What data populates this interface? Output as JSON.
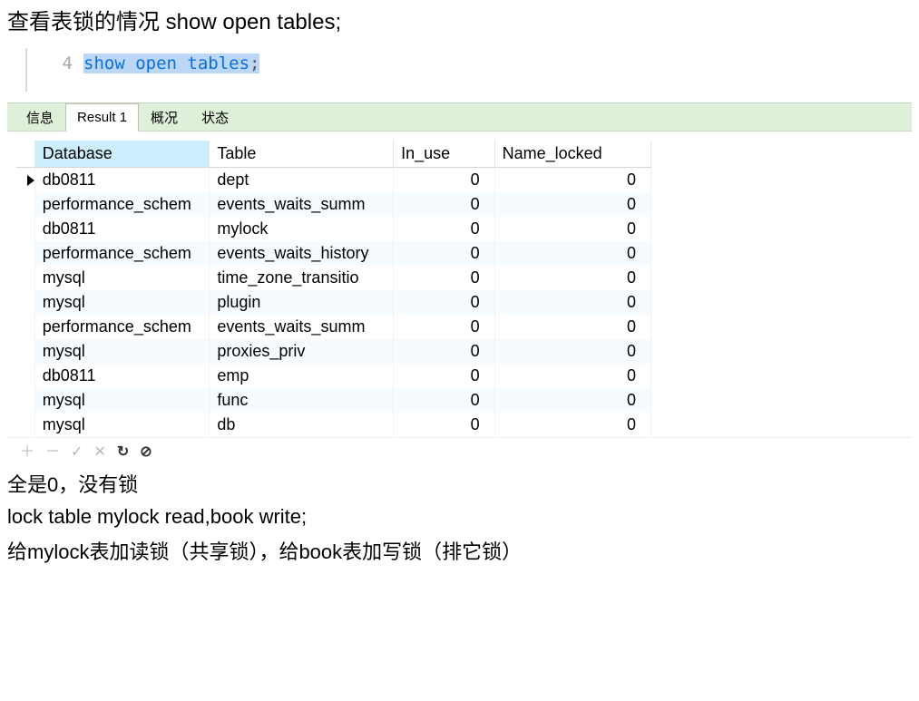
{
  "heading": "查看表锁的情况 show open tables;",
  "code": {
    "line_no": "4",
    "sql": "show open tables",
    "terminator": ";"
  },
  "tabs": {
    "items": [
      {
        "label": "信息",
        "active": false
      },
      {
        "label": "Result 1",
        "active": true
      },
      {
        "label": "概况",
        "active": false
      },
      {
        "label": "状态",
        "active": false
      }
    ]
  },
  "table": {
    "columns": [
      "Database",
      "Table",
      "In_use",
      "Name_locked"
    ],
    "sorted_col": 0,
    "rows": [
      {
        "current": true,
        "cells": [
          "db0811",
          "dept",
          "0",
          "0"
        ]
      },
      {
        "current": false,
        "cells": [
          "performance_schem",
          "events_waits_summ",
          "0",
          "0"
        ]
      },
      {
        "current": false,
        "cells": [
          "db0811",
          "mylock",
          "0",
          "0"
        ]
      },
      {
        "current": false,
        "cells": [
          "performance_schem",
          "events_waits_history",
          "0",
          "0"
        ]
      },
      {
        "current": false,
        "cells": [
          "mysql",
          "time_zone_transitio",
          "0",
          "0"
        ]
      },
      {
        "current": false,
        "cells": [
          "mysql",
          "plugin",
          "0",
          "0"
        ]
      },
      {
        "current": false,
        "cells": [
          "performance_schem",
          "events_waits_summ",
          "0",
          "0"
        ]
      },
      {
        "current": false,
        "cells": [
          "mysql",
          "proxies_priv",
          "0",
          "0"
        ]
      },
      {
        "current": false,
        "cells": [
          "db0811",
          "emp",
          "0",
          "0"
        ]
      },
      {
        "current": false,
        "cells": [
          "mysql",
          "func",
          "0",
          "0"
        ]
      },
      {
        "current": false,
        "cells": [
          "mysql",
          "db",
          "0",
          "0"
        ]
      }
    ]
  },
  "toolbar": {
    "icons": [
      {
        "name": "plus-icon",
        "glyph": "＋",
        "dark": false
      },
      {
        "name": "minus-icon",
        "glyph": "－",
        "dark": false
      },
      {
        "name": "check-icon",
        "glyph": "✓",
        "dark": false
      },
      {
        "name": "cross-icon",
        "glyph": "✕",
        "dark": false
      },
      {
        "name": "refresh-icon",
        "glyph": "↻",
        "dark": true
      },
      {
        "name": "stop-icon",
        "glyph": "⊘",
        "dark": true
      }
    ]
  },
  "notes": {
    "n1": "全是0，没有锁",
    "n2": "lock table mylock read,book write;",
    "n3": "给mylock表加读锁（共享锁），给book表加写锁（排它锁）"
  }
}
